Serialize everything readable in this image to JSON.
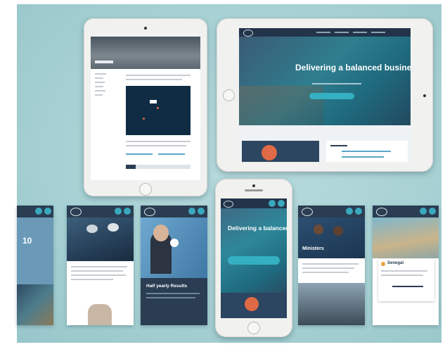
{
  "tablet_right": {
    "hero_heading": "Delivering a balanced business"
  },
  "phone_center": {
    "hero_heading": "Delivering a balanced business"
  },
  "mobile_cards": {
    "card1_number": "10",
    "card3_caption": "Half yearly Results",
    "card5_caption": "Ministers",
    "card6_label": "Senegal"
  },
  "colors": {
    "background": "#a6d0d3",
    "navy": "#2a3d52",
    "accent_teal": "#35b0c2",
    "accent_orange": "#e06a45"
  }
}
